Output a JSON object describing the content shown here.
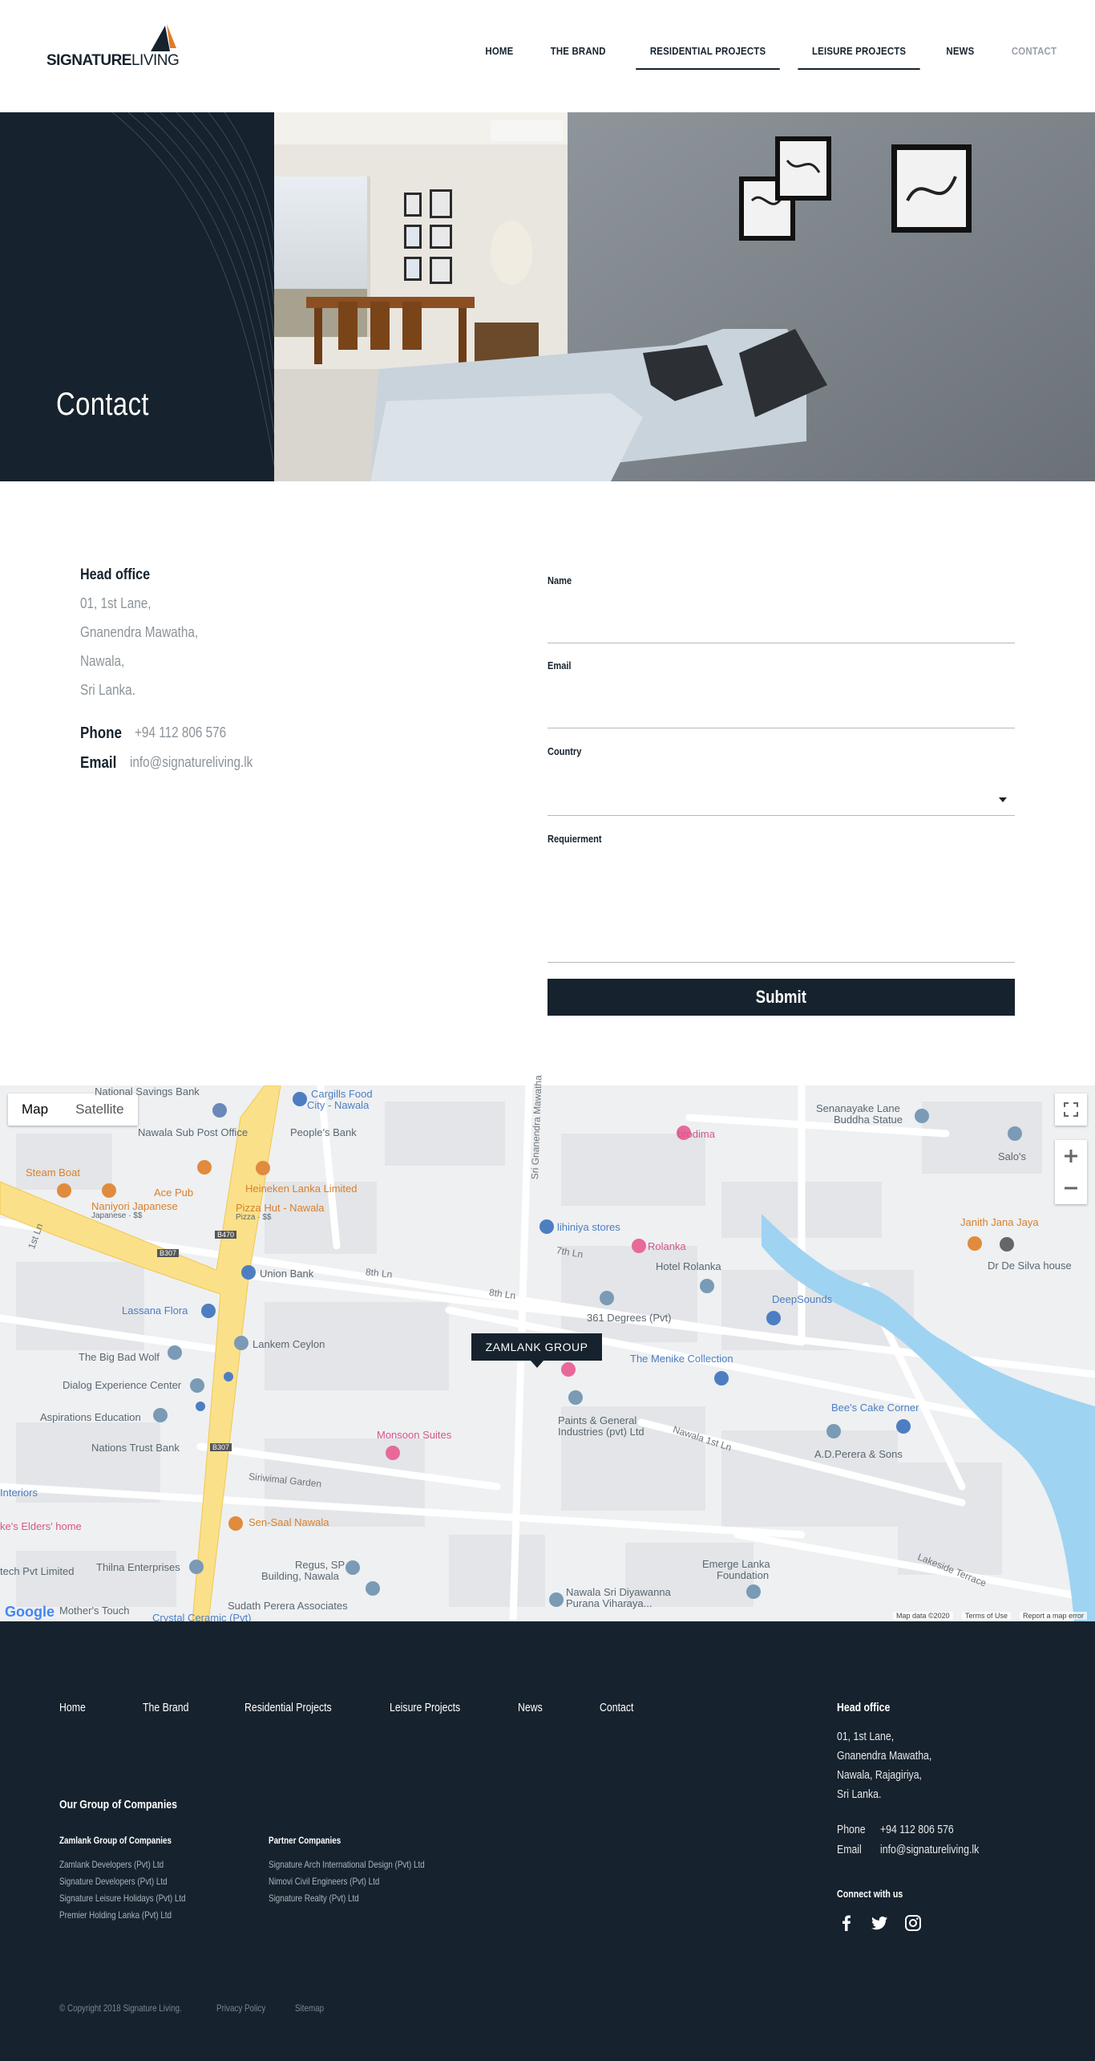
{
  "brand": {
    "word1": "SIGNATURE",
    "word2": "LIVING"
  },
  "nav": [
    {
      "label": "HOME"
    },
    {
      "label": "THE BRAND"
    },
    {
      "label": "RESIDENTIAL PROJECTS"
    },
    {
      "label": "LEISURE PROJECTS"
    },
    {
      "label": "NEWS"
    },
    {
      "label": "CONTACT"
    }
  ],
  "hero": {
    "title": "Contact"
  },
  "contact": {
    "head_office": "Head office",
    "address": [
      "01, 1st Lane,",
      "Gnanendra Mawatha,",
      "Nawala,",
      "Sri Lanka."
    ],
    "phone_label": "Phone",
    "phone": "+94 112 806 576",
    "email_label": "Email",
    "email": "info@signatureliving.lk"
  },
  "form": {
    "name_label": "Name",
    "email_label": "Email",
    "country_label": "Country",
    "requirement_label": "Requierment",
    "submit_label": "Submit"
  },
  "map": {
    "type_map": "Map",
    "type_satellite": "Satellite",
    "marker_label": "ZAMLANK GROUP",
    "data_credit": "Map data ©2020",
    "terms": "Terms of Use",
    "report": "Report a map error",
    "google": "Google",
    "places": [
      {
        "name": "National Savings Bank",
        "color": "gray"
      },
      {
        "name": "Cargills Food",
        "color": "blue"
      },
      {
        "name": "City - Nawala",
        "color": "blue"
      },
      {
        "name": "Nawala Sub Post Office",
        "color": "gray"
      },
      {
        "name": "People's Bank",
        "color": "gray"
      },
      {
        "name": "Senanayake Lane",
        "color": "gray"
      },
      {
        "name": "Buddha Statue",
        "color": "gray"
      },
      {
        "name": "brodima",
        "color": "pink"
      },
      {
        "name": "Salo's",
        "color": "gray"
      },
      {
        "name": "Steam Boat",
        "color": "orange"
      },
      {
        "name": "Ace Pub",
        "color": "orange"
      },
      {
        "name": "Heineken Lanka Limited",
        "color": "orange"
      },
      {
        "name": "Naniyori Japanese",
        "color": "orange"
      },
      {
        "name": "Japanese · $$",
        "color": "gray"
      },
      {
        "name": "Pizza Hut - Nawala",
        "color": "orange"
      },
      {
        "name": "Pizza · $$",
        "color": "gray"
      },
      {
        "name": "lihiniya stores",
        "color": "blue"
      },
      {
        "name": "Rolanka",
        "color": "pink"
      },
      {
        "name": "Hotel Rolanka",
        "color": "gray"
      },
      {
        "name": "Janith Jana Jaya",
        "color": "orange"
      },
      {
        "name": "Dr De Silva house",
        "color": "gray"
      },
      {
        "name": "Union Bank",
        "color": "gray"
      },
      {
        "name": "Lassana Flora",
        "color": "blue"
      },
      {
        "name": "DeepSounds",
        "color": "blue"
      },
      {
        "name": "361 Degrees (Pvt)",
        "color": "gray"
      },
      {
        "name": "The Big Bad Wolf",
        "color": "gray"
      },
      {
        "name": "Lankem Ceylon",
        "color": "gray"
      },
      {
        "name": "The Menike Collection",
        "color": "blue"
      },
      {
        "name": "Dialog Experience Center",
        "color": "gray"
      },
      {
        "name": "Aspirations Education",
        "color": "gray"
      },
      {
        "name": "Paints & General",
        "color": "gray"
      },
      {
        "name": "Industries (pvt) Ltd",
        "color": "gray"
      },
      {
        "name": "Bee's Cake Corner",
        "color": "blue"
      },
      {
        "name": "A.D.Perera & Sons",
        "color": "gray"
      },
      {
        "name": "Nations Trust Bank",
        "color": "gray"
      },
      {
        "name": "Monsoon Suites",
        "color": "pink"
      },
      {
        "name": "Interiors",
        "color": "blue"
      },
      {
        "name": "ke's Elders' home",
        "color": "pink"
      },
      {
        "name": "Sen-Saal Nawala",
        "color": "orange"
      },
      {
        "name": "tech Pvt Limited",
        "color": "gray"
      },
      {
        "name": "Thilna Enterprises",
        "color": "gray"
      },
      {
        "name": "Regus, SP",
        "color": "gray"
      },
      {
        "name": "Building, Nawala",
        "color": "gray"
      },
      {
        "name": "Emerge Lanka",
        "color": "gray"
      },
      {
        "name": "Foundation",
        "color": "gray"
      },
      {
        "name": "Sudath Perera Associates",
        "color": "gray"
      },
      {
        "name": "Nawala Sri Diyawanna",
        "color": "gray"
      },
      {
        "name": "Purana Viharaya...",
        "color": "gray"
      },
      {
        "name": "Mother's Touch",
        "color": "gray"
      },
      {
        "name": "Crystal Ceramic (Pvt)",
        "color": "blue"
      }
    ],
    "roads": [
      "Sri Gnanendra Mawatha",
      "8th Ln",
      "7th Ln",
      "Nawala 1st Ln",
      "Siriwimal Garden",
      "Lakeside Terrace",
      "1st Ln",
      "B307",
      "B470"
    ]
  },
  "footer": {
    "nav": [
      "Home",
      "The Brand",
      "Residential Projects",
      "Leisure Projects",
      "News",
      "Contact"
    ],
    "group_title": "Our Group of Companies",
    "zamlank_title": "Zamlank Group of Companies",
    "zamlank_items": [
      "Zamlank Developers (Pvt) Ltd",
      "Signature Developers (Pvt) Ltd",
      "Signature Leisure Holidays (Pvt) Ltd",
      "Premier Holding Lanka (Pvt) Ltd"
    ],
    "partner_title": "Partner Companies",
    "partner_items": [
      "Signature Arch International Design (Pvt) Ltd",
      "Nimovi Civil Engineers (Pvt) Ltd",
      "Signature Realty (Pvt) Ltd"
    ],
    "head_office": "Head office",
    "address": [
      "01, 1st Lane,",
      "Gnanendra Mawatha,",
      "Nawala, Rajagiriya,",
      "Sri Lanka."
    ],
    "phone_label": "Phone",
    "phone": "+94 112 806 576",
    "email_label": "Email",
    "email": "info@signatureliving.lk",
    "connect": "Connect with us",
    "social_icons": [
      "facebook-icon",
      "twitter-icon",
      "instagram-icon"
    ],
    "copyright": "© Copyright 2018 Signature Living.",
    "privacy": "Privacy Policy",
    "sitemap": "Sitemap"
  },
  "colors": {
    "navy": "#16222d",
    "muted": "#8d949a",
    "water": "#9fd3f2",
    "map_bg": "#eef0f2",
    "main_road": "#fbe08a"
  }
}
